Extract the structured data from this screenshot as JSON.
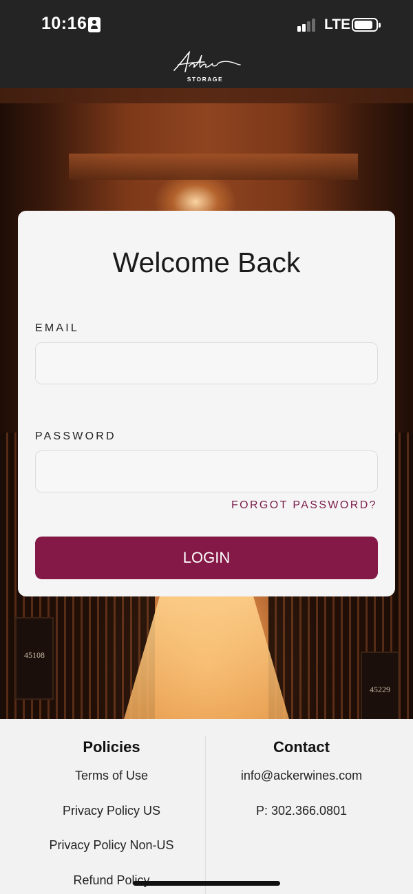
{
  "status_bar": {
    "time": "10:16",
    "network": "LTE"
  },
  "header": {
    "logo_text": "Acker",
    "logo_subtext": "STORAGE"
  },
  "hero": {
    "crate_left_label": "45108",
    "crate_right_label": "45229"
  },
  "login_card": {
    "title": "Welcome Back",
    "email_label": "EMAIL",
    "email_value": "",
    "password_label": "PASSWORD",
    "password_value": "",
    "forgot_password": "FORGOT PASSWORD?",
    "login_button": "LOGIN"
  },
  "footer": {
    "policies_heading": "Policies",
    "policies": [
      "Terms of Use",
      "Privacy Policy US",
      "Privacy Policy Non-US",
      "Refund Policy"
    ],
    "contact_heading": "Contact",
    "contact_email": "info@ackerwines.com",
    "contact_phone": "P: 302.366.0801"
  },
  "colors": {
    "header_bg": "#242424",
    "accent": "#841847",
    "forgot_link": "#7a1c4a",
    "card_bg": "#f5f5f5",
    "footer_bg": "#f2f2f2"
  },
  "icons": [
    "contact-card-icon",
    "signal-icon",
    "battery-icon"
  ]
}
